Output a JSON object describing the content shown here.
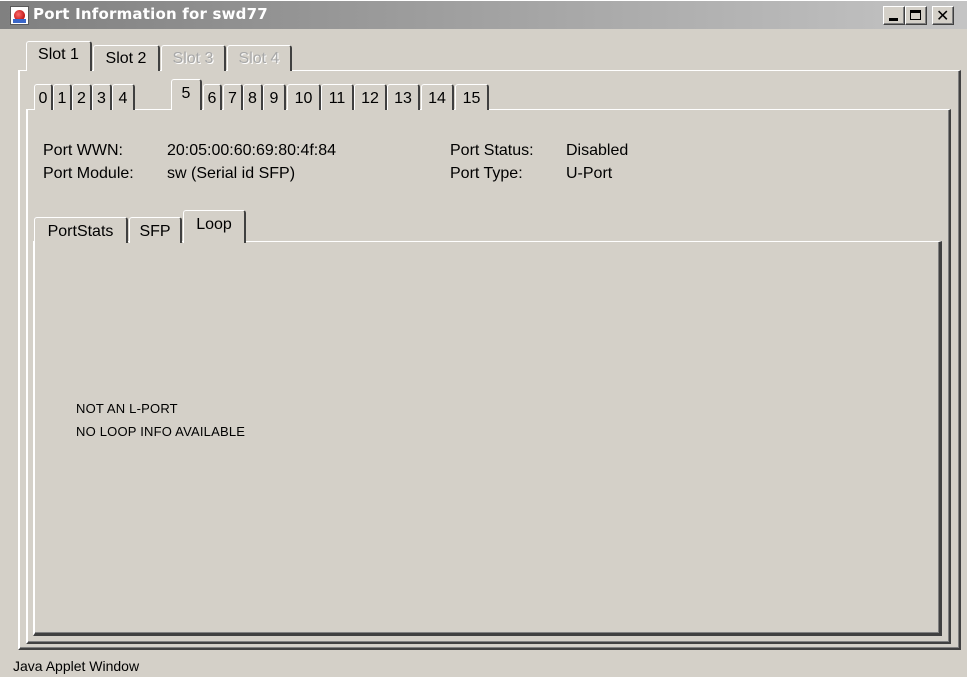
{
  "window": {
    "title": "Port Information for swd77",
    "status_bar": "Java Applet Window",
    "close_glyph": "✕"
  },
  "slot_tabs": [
    {
      "label": "Slot 1",
      "selected": true,
      "enabled": true
    },
    {
      "label": "Slot 2",
      "selected": false,
      "enabled": true
    },
    {
      "label": "Slot 3",
      "selected": false,
      "enabled": false
    },
    {
      "label": "Slot 4",
      "selected": false,
      "enabled": false
    }
  ],
  "port_tabs": [
    "0",
    "1",
    "2",
    "3",
    "4",
    "5",
    "6",
    "7",
    "8",
    "9",
    "10",
    "11",
    "12",
    "13",
    "14",
    "15"
  ],
  "selected_port": "5",
  "port_info": {
    "wwn_label": "Port WWN:",
    "wwn_value": "20:05:00:60:69:80:4f:84",
    "module_label": "Port Module:",
    "module_value": "sw (Serial id SFP)",
    "status_label": "Port Status:",
    "status_value": "Disabled",
    "type_label": "Port Type:",
    "type_value": "U-Port"
  },
  "sub_tabs": [
    {
      "label": "PortStats",
      "selected": false
    },
    {
      "label": "SFP",
      "selected": false
    },
    {
      "label": "Loop",
      "selected": true
    }
  ],
  "loop": {
    "line1": "NOT AN L-PORT",
    "line2": "NO LOOP INFO AVAILABLE"
  },
  "icons": {
    "app": "java-applet-icon",
    "minimize": "minimize-icon",
    "maximize": "maximize-icon",
    "close": "close-icon"
  }
}
